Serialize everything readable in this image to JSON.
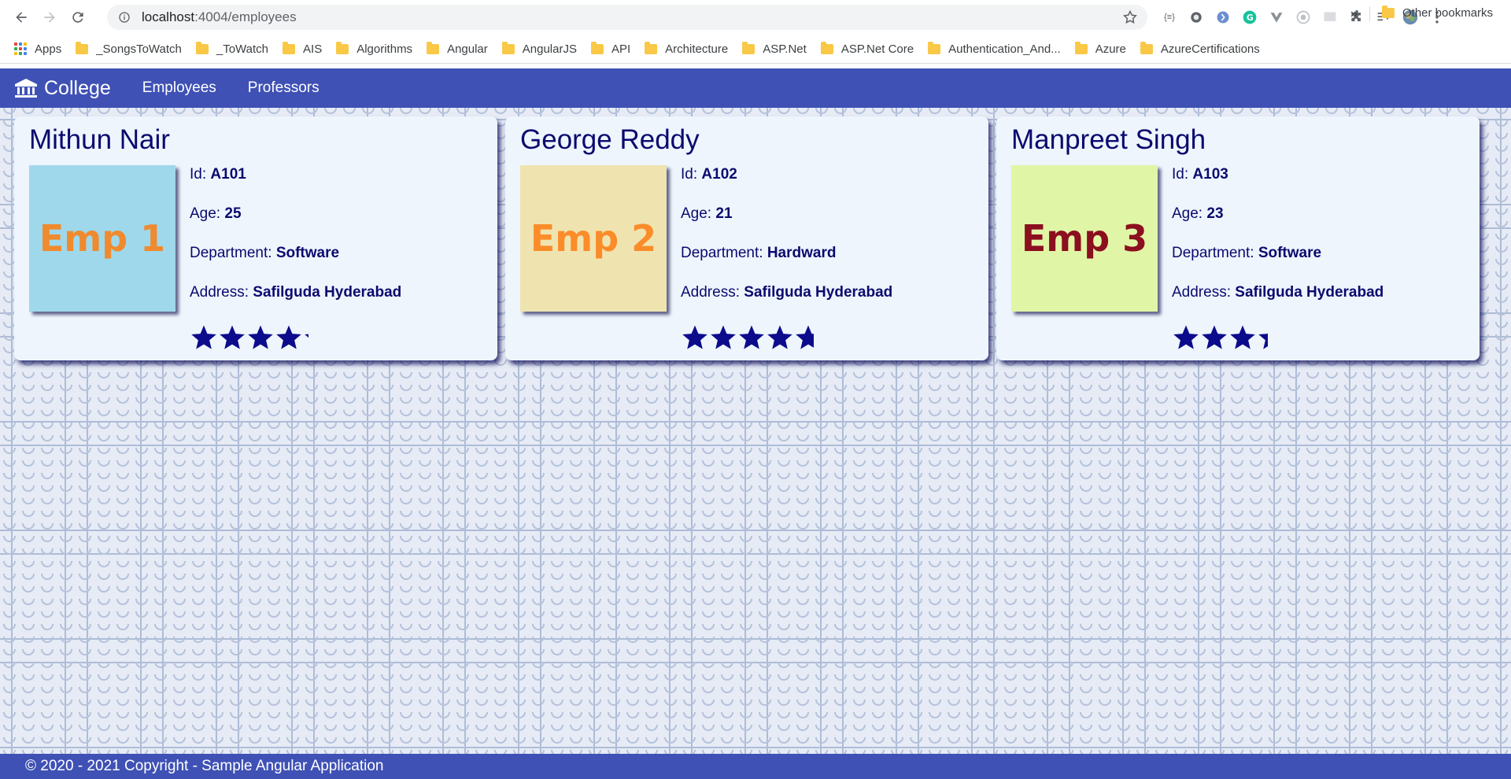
{
  "browser": {
    "url_host": "localhost",
    "url_rest": ":4004/employees",
    "bookmarks": [
      {
        "label": "Apps",
        "type": "apps"
      },
      {
        "label": "_SongsToWatch",
        "type": "folder"
      },
      {
        "label": "_ToWatch",
        "type": "folder"
      },
      {
        "label": "AIS",
        "type": "folder"
      },
      {
        "label": "Algorithms",
        "type": "folder"
      },
      {
        "label": "Angular",
        "type": "folder"
      },
      {
        "label": "AngularJS",
        "type": "folder"
      },
      {
        "label": "API",
        "type": "folder"
      },
      {
        "label": "Architecture",
        "type": "folder"
      },
      {
        "label": "ASP.Net",
        "type": "folder"
      },
      {
        "label": "ASP.Net Core",
        "type": "folder"
      },
      {
        "label": "Authentication_And...",
        "type": "folder"
      },
      {
        "label": "Azure",
        "type": "folder"
      },
      {
        "label": "AzureCertifications",
        "type": "folder"
      }
    ],
    "overflow": "»",
    "other_bookmarks": "Other bookmarks",
    "extension_json_label": "{≡}"
  },
  "navbar": {
    "brand": "College",
    "links": [
      "Employees",
      "Professors"
    ],
    "color": "#3f51b5"
  },
  "employees": [
    {
      "name": "Mithun Nair",
      "photo_text": "Emp 1",
      "photo_bg": "#9fd8ea",
      "photo_fg": "#f08a2e",
      "id_label": "Id: ",
      "id": "A101",
      "age_label": "Age: ",
      "age": "25",
      "department_label": "Department: ",
      "department": "Software",
      "address_label": "Address: ",
      "address": "Safilguda Hyderabad",
      "rating": 4.2
    },
    {
      "name": "George Reddy",
      "photo_text": "Emp 2",
      "photo_bg": "#efe4b0",
      "photo_fg": "#fb8c2a",
      "id_label": "Id: ",
      "id": "A102",
      "age_label": "Age: ",
      "age": "21",
      "department_label": "Department: ",
      "department": "Hardward",
      "address_label": "Address: ",
      "address": "Safilguda Hyderabad",
      "rating": 4.7
    },
    {
      "name": "Manpreet Singh",
      "photo_text": "Emp 3",
      "photo_bg": "#e1f5a6",
      "photo_fg": "#8b0f1f",
      "id_label": "Id: ",
      "id": "A103",
      "age_label": "Age: ",
      "age": "23",
      "department_label": "Department: ",
      "department": "Software",
      "address_label": "Address: ",
      "address": "Safilguda Hyderabad",
      "rating": 3.4
    }
  ],
  "star_color": "#0b0b8c",
  "footer": {
    "text": "© 2020 - 2021 Copyright - Sample Angular Application"
  }
}
